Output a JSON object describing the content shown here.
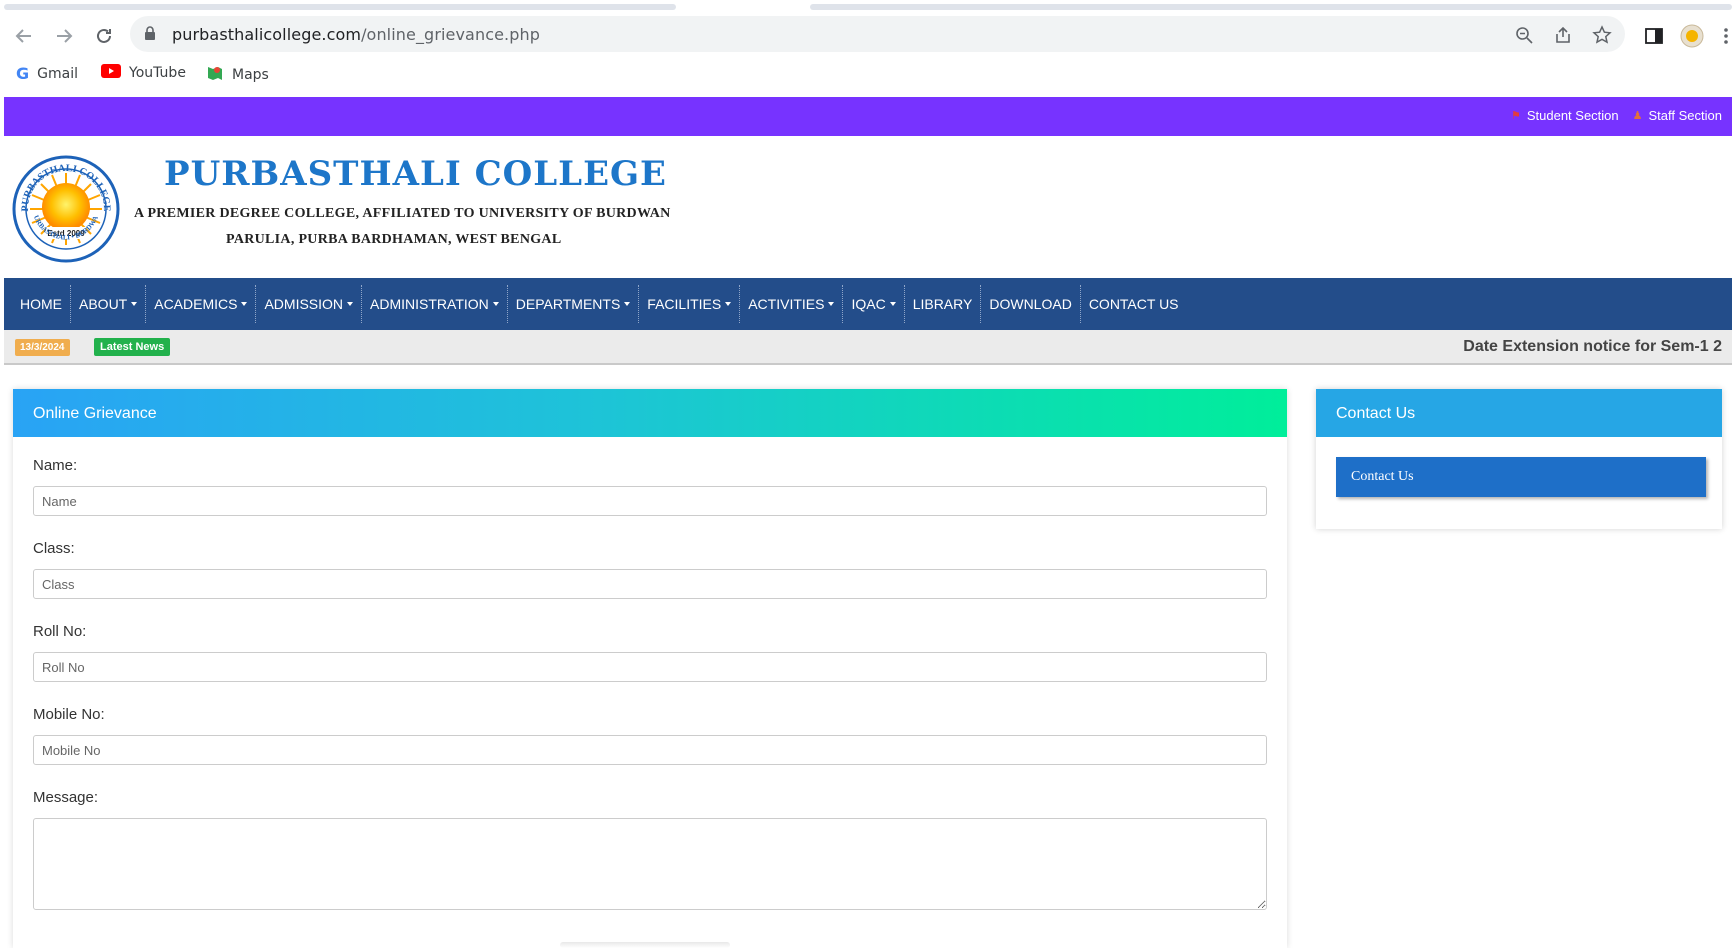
{
  "browser": {
    "url_domain": "purbasthalicollege.com",
    "url_path": "/online_grievance.php",
    "bookmarks": [
      {
        "label": "Gmail",
        "icon": "gmail-icon"
      },
      {
        "label": "YouTube",
        "icon": "youtube-icon"
      },
      {
        "label": "Maps",
        "icon": "maps-icon"
      }
    ]
  },
  "topbar": {
    "student_section": "Student Section",
    "staff_section": "Staff Section",
    "color": "#7733ff"
  },
  "header": {
    "title": "PURBASTHALI COLLEGE",
    "subtitle": "A PREMIER DEGREE COLLEGE, AFFILIATED TO UNIVERSITY OF BURDWAN",
    "address": "PARULIA, PURBA BARDHAMAN, WEST BENGAL",
    "logo_text_top": "PURBASTHALI COLLEGE",
    "logo_text_bottom": "PURBASTHALI • BURDWAN",
    "logo_estd": "Estd 2009"
  },
  "menu": {
    "items": [
      {
        "label": "HOME",
        "dropdown": false
      },
      {
        "label": "ABOUT",
        "dropdown": true
      },
      {
        "label": "ACADEMICS",
        "dropdown": true
      },
      {
        "label": "ADMISSION",
        "dropdown": true
      },
      {
        "label": "ADMINISTRATION",
        "dropdown": true
      },
      {
        "label": "DEPARTMENTS",
        "dropdown": true
      },
      {
        "label": "FACILITIES",
        "dropdown": true
      },
      {
        "label": "ACTIVITIES",
        "dropdown": true
      },
      {
        "label": "IQAC",
        "dropdown": true
      },
      {
        "label": "LIBRARY",
        "dropdown": false
      },
      {
        "label": "DOWNLOAD",
        "dropdown": false
      },
      {
        "label": "CONTACT US",
        "dropdown": false
      }
    ]
  },
  "ticker": {
    "date": "13/3/2024",
    "badge": "Latest News",
    "text": "Date Extension notice for Sem-1 2"
  },
  "grievance": {
    "title": "Online Grievance",
    "fields": {
      "name_label": "Name:",
      "name_placeholder": "Name",
      "class_label": "Class:",
      "class_placeholder": "Class",
      "roll_label": "Roll No:",
      "roll_placeholder": "Roll No",
      "mobile_label": "Mobile No:",
      "mobile_placeholder": "Mobile No",
      "message_label": "Message:"
    }
  },
  "sidebar": {
    "title": "Contact Us",
    "button": "Contact Us"
  }
}
